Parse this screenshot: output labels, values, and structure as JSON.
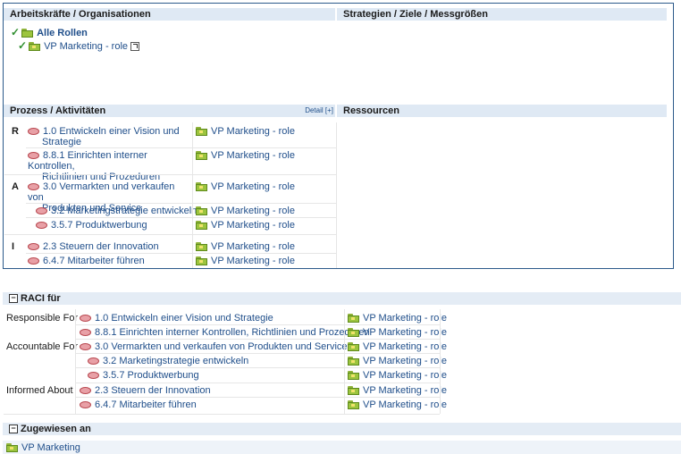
{
  "top": {
    "left_header": "Arbeitskräfte / Organisationen",
    "right_header": "Strategien / Ziele / Messgrößen",
    "all_roles": "Alle Rollen",
    "role_link": "VP Marketing - role",
    "process_header": "Prozess / Aktivitäten",
    "detail_label": "Detail [+]",
    "resources_header": "Ressourcen",
    "groups": [
      {
        "letter": "R",
        "items": [
          {
            "activity": "1.0 Entwickeln einer Vision und Strategie",
            "line1": "1.0 Entwickeln einer Vision und",
            "line2": "Strategie",
            "role": "VP Marketing - role"
          },
          {
            "activity": "8.8.1 Einrichten interner Kontrollen, Richtlinien und Prozeduren",
            "line1": "8.8.1 Einrichten interner Kontrollen,",
            "line2": "Richtlinien und Prozeduren",
            "role": "VP Marketing - role"
          }
        ]
      },
      {
        "letter": "A",
        "items": [
          {
            "line1": "3.0 Vermarkten und verkaufen von",
            "line2": "Produkten und Service",
            "role": "VP Marketing - role"
          },
          {
            "line1": "3.2 Marketingstrategie entwickeln",
            "line2": "",
            "role": "VP Marketing - role"
          },
          {
            "line1": "3.5.7 Produktwerbung",
            "line2": "",
            "role": "VP Marketing - role"
          }
        ]
      },
      {
        "letter": "I",
        "items": [
          {
            "line1": "2.3 Steuern der Innovation",
            "line2": "",
            "role": "VP Marketing - role"
          },
          {
            "line1": "6.4.7 Mitarbeiter führen",
            "line2": "",
            "role": "VP Marketing - role"
          }
        ]
      }
    ]
  },
  "raci": {
    "header": "RACI für",
    "toggle": "−",
    "rows": [
      {
        "label": "Responsible For",
        "activity": "1.0 Entwickeln einer Vision und Strategie",
        "role": "VP Marketing - role"
      },
      {
        "label": "",
        "activity": "8.8.1 Einrichten interner Kontrollen, Richtlinien und Prozeduren",
        "role": "VP Marketing - role"
      },
      {
        "label": "Accountable For",
        "activity": "3.0 Vermarkten und verkaufen von Produkten und Service",
        "role": "VP Marketing - role"
      },
      {
        "label": "",
        "activity": "3.2 Marketingstrategie entwickeln",
        "role": "VP Marketing - role"
      },
      {
        "label": "",
        "activity": "3.5.7 Produktwerbung",
        "role": "VP Marketing - role"
      },
      {
        "label": "Informed About",
        "activity": "2.3 Steuern der Innovation",
        "role": "VP Marketing - role"
      },
      {
        "label": "",
        "activity": "6.4.7 Mitarbeiter führen",
        "role": "VP Marketing - role"
      }
    ]
  },
  "assigned": {
    "header": "Zugewiesen an",
    "toggle": "−",
    "item": "VP Marketing"
  }
}
